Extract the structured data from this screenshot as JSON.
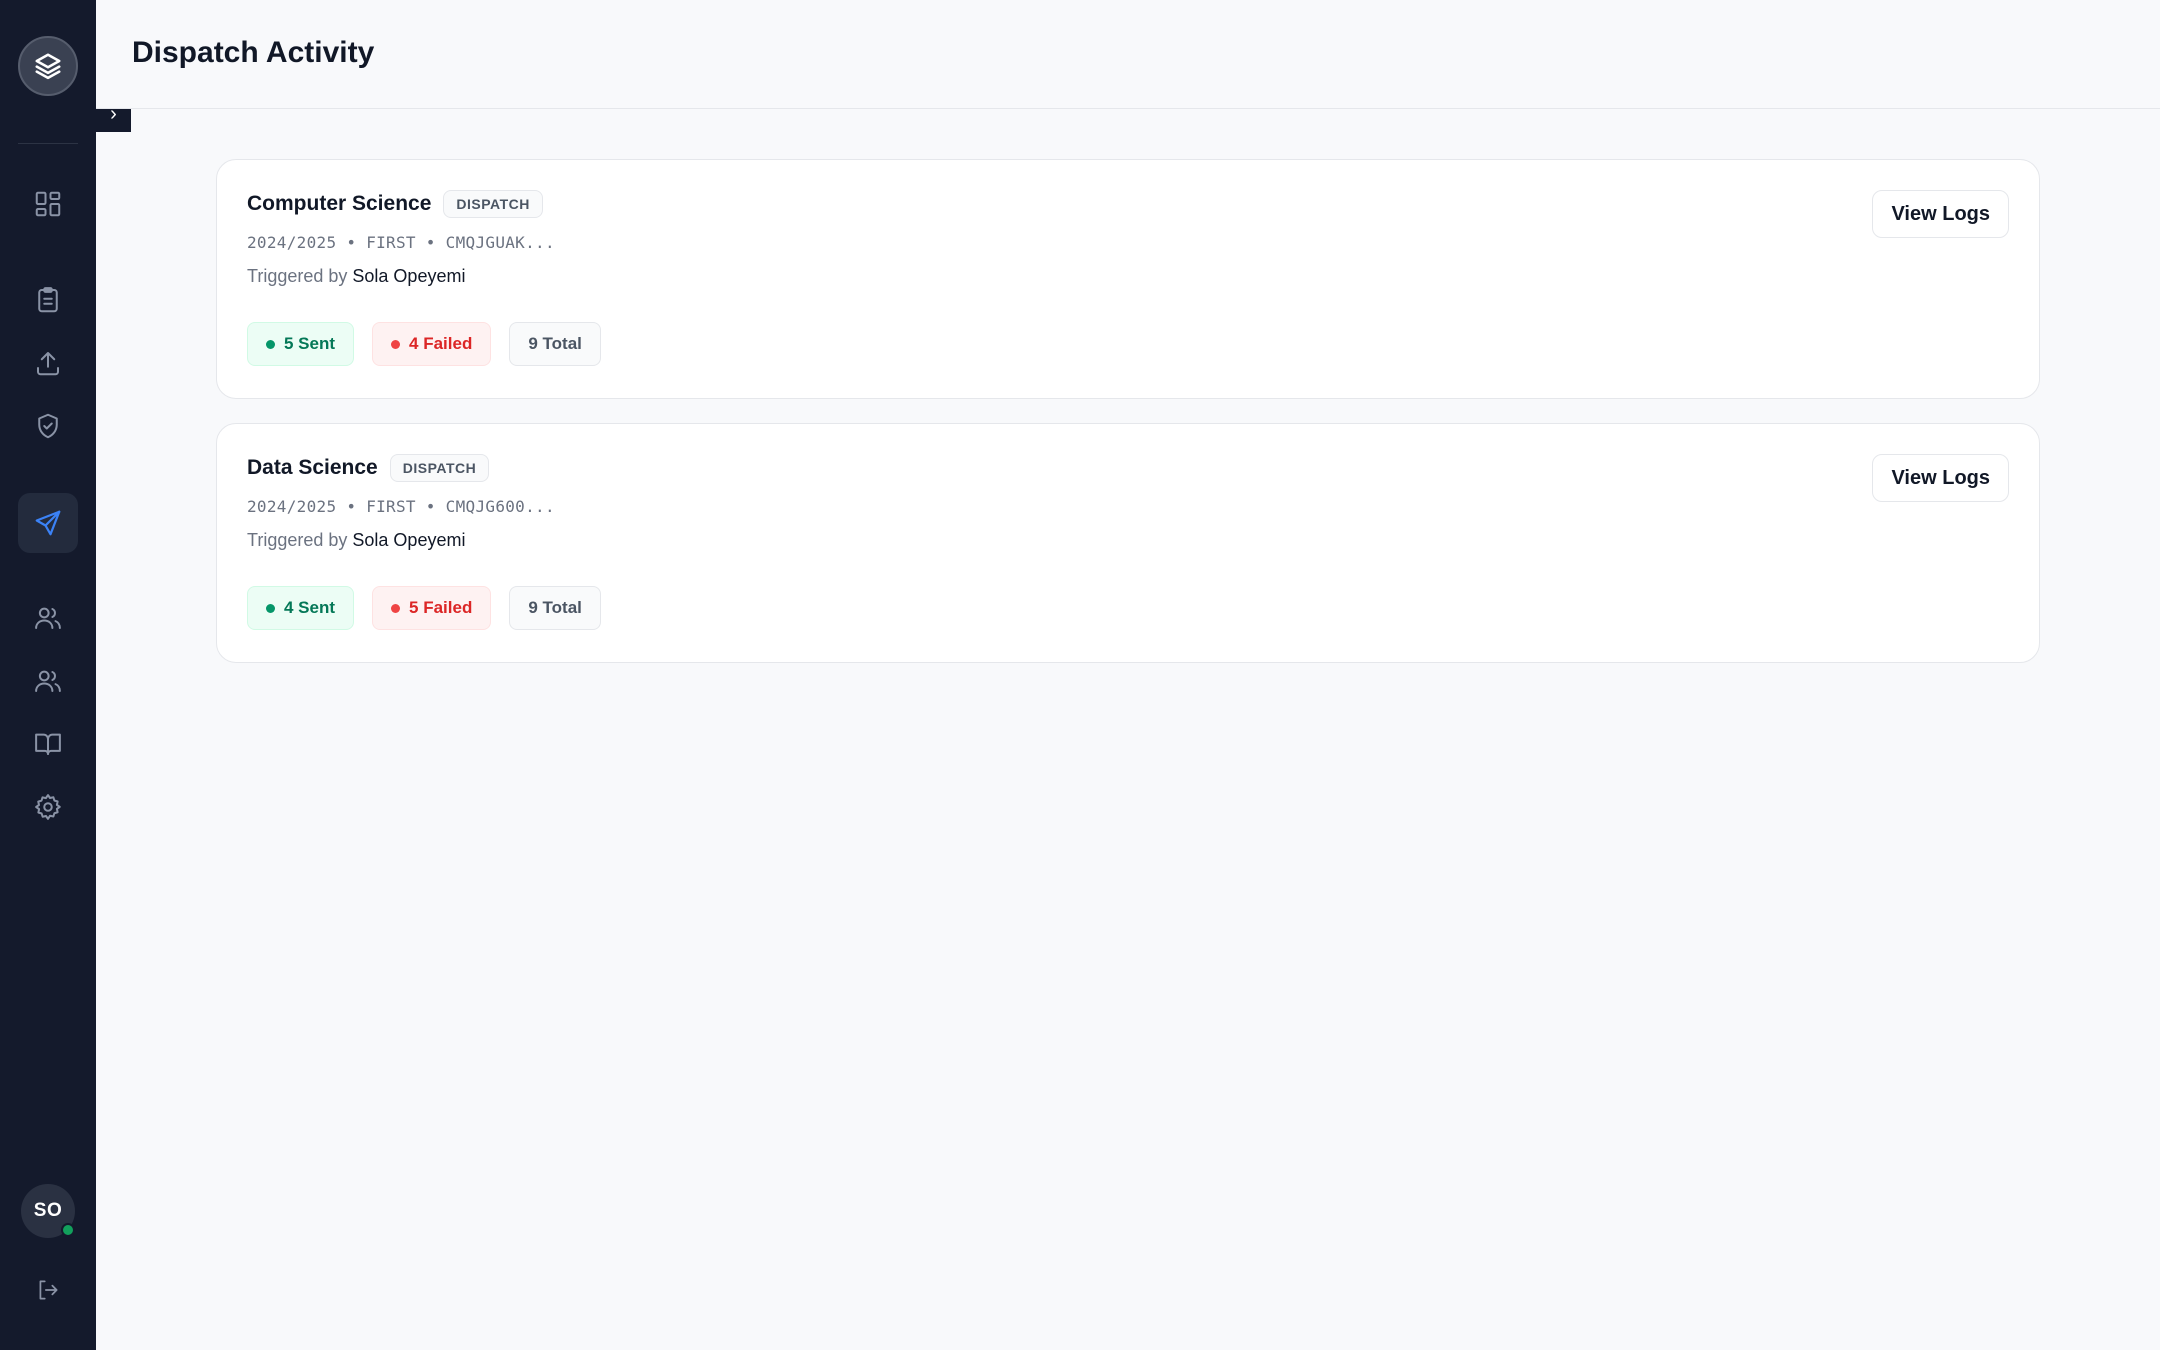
{
  "header": {
    "title": "Dispatch Activity"
  },
  "sidebar": {
    "logo_icon": "layers-icon",
    "items": [
      {
        "name": "dashboard",
        "icon": "grid-icon",
        "active": false
      },
      {
        "name": "results",
        "icon": "clipboard-icon",
        "active": false
      },
      {
        "name": "upload",
        "icon": "upload-icon",
        "active": false
      },
      {
        "name": "approvals",
        "icon": "shield-check-icon",
        "active": false
      },
      {
        "name": "dispatch",
        "icon": "send-icon",
        "active": true
      },
      {
        "name": "students",
        "icon": "users-icon",
        "active": false
      },
      {
        "name": "staff",
        "icon": "users-icon",
        "active": false
      },
      {
        "name": "courses",
        "icon": "book-icon",
        "active": false
      },
      {
        "name": "settings",
        "icon": "gear-icon",
        "active": false
      }
    ],
    "toggle_glyph": "›",
    "user": {
      "initials": "SO",
      "status_color": "#12a05c"
    },
    "logout_icon": "logout-icon",
    "accent_color": "#3b82f6"
  },
  "dispatches": [
    {
      "title": "Computer Science",
      "badge": "DISPATCH",
      "meta": "2024/2025 • FIRST • CMQJGUAK...",
      "triggered_label": "Triggered by",
      "triggered_by": "Sola Opeyemi",
      "sent": "5 Sent",
      "failed": "4 Failed",
      "total": "9 Total",
      "action": "View Logs"
    },
    {
      "title": "Data Science",
      "badge": "DISPATCH",
      "meta": "2024/2025 • FIRST • CMQJG600...",
      "triggered_label": "Triggered by",
      "triggered_by": "Sola Opeyemi",
      "sent": "4 Sent",
      "failed": "5 Failed",
      "total": "9 Total",
      "action": "View Logs"
    }
  ],
  "colors": {
    "sidebar_bg": "#141a2c",
    "sent_text": "#047857",
    "failed_text": "#dc2626",
    "total_text": "#4b5563"
  }
}
